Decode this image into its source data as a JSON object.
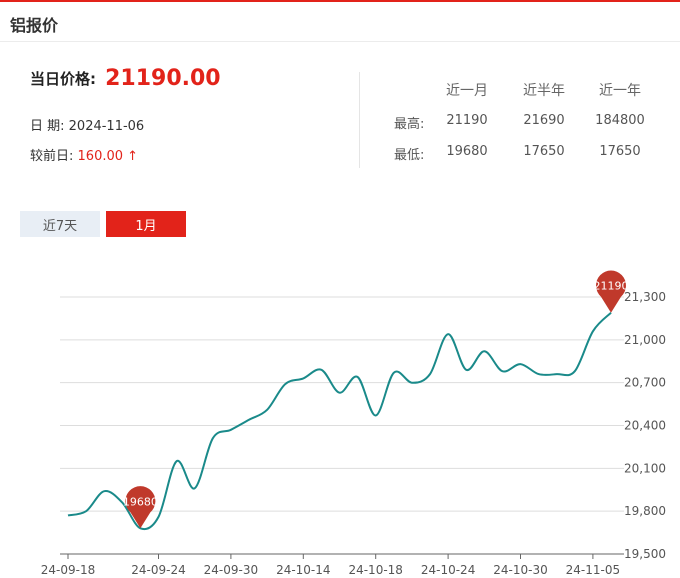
{
  "page_title": "铝报价",
  "price": {
    "label": "当日价格:",
    "value": "21190.00"
  },
  "date": {
    "label": "日 期:",
    "value": "2024-11-06"
  },
  "change": {
    "label": "较前日:",
    "value": "160.00 ↑"
  },
  "stats": {
    "headers": [
      "近一月",
      "近半年",
      "近一年"
    ],
    "rows": [
      {
        "label": "最高:",
        "values": [
          "21190",
          "21690",
          "184800"
        ]
      },
      {
        "label": "最低:",
        "values": [
          "19680",
          "17650",
          "17650"
        ]
      }
    ]
  },
  "tabs": [
    "近7天",
    "1月"
  ],
  "colors": {
    "accent": "#e2231a",
    "line": "#1a8a8a",
    "marker": "#c0392b"
  },
  "chart_data": {
    "type": "line",
    "x_ticks": [
      "24-09-18",
      "24-09-24",
      "24-09-30",
      "24-10-14",
      "24-10-18",
      "24-10-24",
      "24-10-30",
      "24-11-05"
    ],
    "y_ticks": [
      "19,500",
      "19,800",
      "20,100",
      "20,400",
      "20,700",
      "21,000",
      "21,300"
    ],
    "ylim": [
      19500,
      21300
    ],
    "grid": true,
    "series": [
      {
        "points": [
          [
            "24-09-18",
            19770
          ],
          [
            "",
            19800
          ],
          [
            "",
            19940
          ],
          [
            "",
            19860
          ],
          [
            "",
            19680
          ],
          [
            "24-09-24",
            19760
          ],
          [
            "",
            20150
          ],
          [
            "",
            19960
          ],
          [
            "",
            20310
          ],
          [
            "24-09-30",
            20370
          ],
          [
            "",
            20440
          ],
          [
            "",
            20510
          ],
          [
            "",
            20690
          ],
          [
            "24-10-14",
            20730
          ],
          [
            "",
            20790
          ],
          [
            "",
            20630
          ],
          [
            "",
            20740
          ],
          [
            "24-10-18",
            20470
          ],
          [
            "",
            20770
          ],
          [
            "",
            20700
          ],
          [
            "",
            20760
          ],
          [
            "24-10-24",
            21040
          ],
          [
            "",
            20790
          ],
          [
            "",
            20920
          ],
          [
            "",
            20780
          ],
          [
            "24-10-30",
            20830
          ],
          [
            "",
            20760
          ],
          [
            "",
            20760
          ],
          [
            "",
            20780
          ],
          [
            "24-11-05",
            21060
          ],
          [
            "",
            21190
          ]
        ]
      }
    ],
    "markers": [
      {
        "label": "19680",
        "value": 19680
      },
      {
        "label": "21190",
        "value": 21190
      }
    ]
  }
}
